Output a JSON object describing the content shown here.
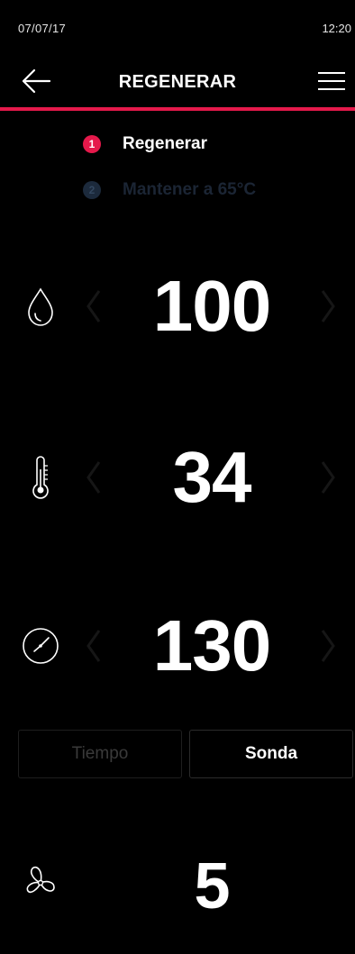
{
  "status": {
    "date": "07/07/17",
    "time": "12:20"
  },
  "header": {
    "title": "REGENERAR",
    "back_icon": "arrow-left-icon",
    "menu_icon": "hamburger-menu-icon"
  },
  "accent_color": "#e5194b",
  "steps": [
    {
      "number": "1",
      "label": "Regenerar",
      "active": true
    },
    {
      "number": "2",
      "label": "Mantener a 65°C",
      "active": false
    }
  ],
  "parameters": {
    "humidity": {
      "icon": "water-drop-icon",
      "value": "100"
    },
    "temperature": {
      "icon": "thermometer-icon",
      "value": "34"
    },
    "time": {
      "icon": "clock-icon",
      "value": "130"
    },
    "fan": {
      "icon": "fan-icon",
      "value": "5"
    }
  },
  "mode": {
    "options": [
      {
        "label": "Tiempo",
        "selected": false
      },
      {
        "label": "Sonda",
        "selected": true
      }
    ]
  }
}
